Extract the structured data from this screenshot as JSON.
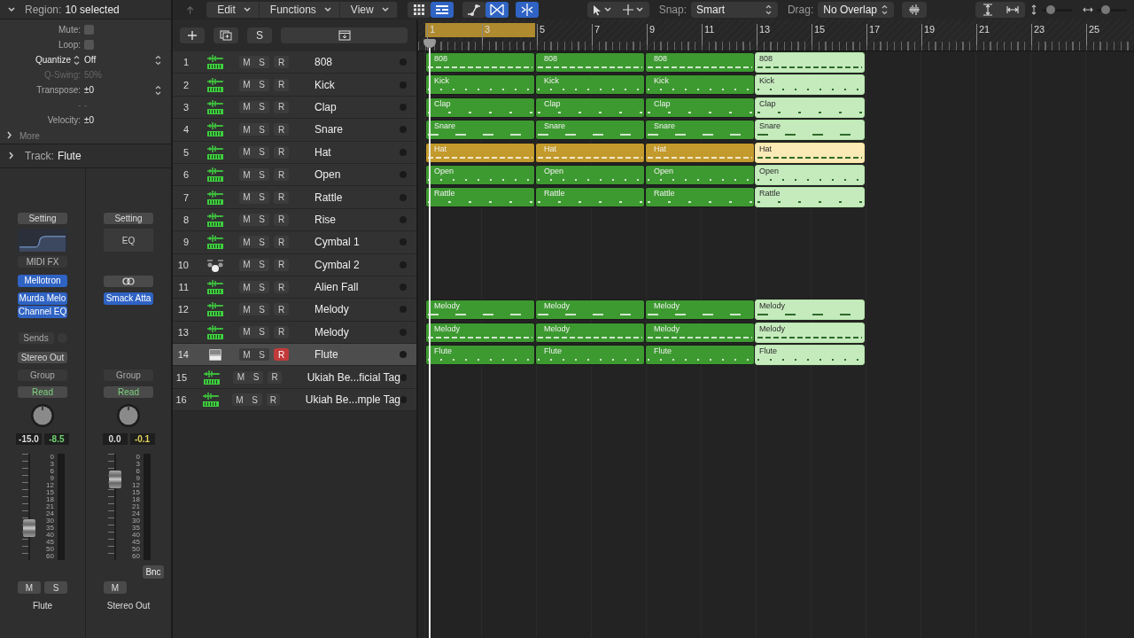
{
  "inspector": {
    "region": {
      "label": "Region:",
      "value": "10 selected",
      "expanded": true,
      "params": [
        {
          "kind": "checkbox",
          "label": "Mute:",
          "checked": false
        },
        {
          "kind": "checkbox",
          "label": "Loop:",
          "checked": false
        },
        {
          "kind": "popup",
          "label": "Quantize",
          "value": "Off"
        },
        {
          "kind": "value",
          "label": "Q-Swing:",
          "value": "50%",
          "disabled": true
        },
        {
          "kind": "stepper",
          "label": "Transpose:",
          "value": "±0"
        },
        {
          "kind": "value",
          "label": "-",
          "value": "-",
          "disabled": true
        },
        {
          "kind": "value",
          "label": "Velocity:",
          "value": "±0"
        }
      ]
    },
    "more": {
      "label": "More",
      "expanded": false
    },
    "track": {
      "label": "Track:",
      "value": "Flute",
      "expanded": false
    }
  },
  "strips": [
    {
      "setting": "Setting",
      "eq": {
        "kind": "curve"
      },
      "midi_fx": "MIDI FX",
      "input": {
        "kind": "plugin",
        "label": "Mellotron"
      },
      "plugins": [
        "Murda Melo",
        "Channel EQ"
      ],
      "sends": "Sends",
      "output": "Stereo Out",
      "group": "Group",
      "automation": "Read",
      "volume": "-15.0",
      "peak": "-8.5",
      "color": "#6fd36f",
      "level": 0.3,
      "scale": [
        "0",
        "3",
        "6",
        "9",
        "12",
        "15",
        "18",
        "21",
        "24",
        "30",
        "35",
        "40",
        "45",
        "50",
        "60"
      ],
      "buttons": [
        "M",
        "S"
      ],
      "name": "Flute"
    },
    {
      "setting": "Setting",
      "eq": {
        "kind": "label",
        "label": "EQ"
      },
      "input": {
        "kind": "link"
      },
      "plugins": [
        "Smack Atta"
      ],
      "group": "Group",
      "automation": "Read",
      "volume": "0.0",
      "peak": "-0.1",
      "color": "#e0d25a",
      "level": 0.76,
      "scale": [
        "0",
        "3",
        "6",
        "9",
        "12",
        "15",
        "18",
        "21",
        "24",
        "30",
        "35",
        "40",
        "45",
        "50",
        "60"
      ],
      "bounce": "Bnc",
      "buttons": [
        "M"
      ],
      "name": "Stereo Out"
    }
  ],
  "toolbar": {
    "menus": [
      "Edit",
      "Functions",
      "View"
    ],
    "toggles": [
      {
        "kind": "grid",
        "selected": false
      },
      {
        "kind": "list",
        "selected": true
      },
      {
        "kind": "automation",
        "selected": false
      },
      {
        "kind": "flex",
        "selected": true
      },
      {
        "kind": "catch",
        "selected": true
      }
    ],
    "snap": {
      "label": "Snap:",
      "value": "Smart"
    },
    "drag": {
      "label": "Drag:",
      "value": "No Overlap"
    },
    "zoom_sliders": [
      {
        "kind": "vertical",
        "level": 0.3
      },
      {
        "kind": "horizontal",
        "level": 0.3
      }
    ]
  },
  "track_header_bar": {
    "solo_button": "S"
  },
  "ruler": {
    "cycle": true,
    "marks": [
      "1",
      "3",
      "5",
      "7",
      "9",
      "11",
      "13",
      "15",
      "17",
      "19",
      "21",
      "23",
      "25"
    ]
  },
  "tracks": [
    {
      "number": "1",
      "kind": "midi",
      "buttons": [
        "M",
        "S",
        "R"
      ],
      "record": false,
      "name": "808",
      "selected": false,
      "regions": [
        {
          "label": "808",
          "selected": false,
          "color": "#3d9a30"
        },
        {
          "label": "808",
          "selected": false,
          "color": "#3d9a30"
        },
        {
          "label": "808",
          "selected": false,
          "color": "#3d9a30"
        },
        {
          "label": "808",
          "selected": true,
          "color": "#c5ebbd"
        }
      ]
    },
    {
      "number": "2",
      "kind": "midi",
      "buttons": [
        "M",
        "S",
        "R"
      ],
      "record": false,
      "name": "Kick",
      "selected": false,
      "regions": [
        {
          "label": "Kick",
          "selected": false,
          "color": "#3d9a30"
        },
        {
          "label": "Kick",
          "selected": false,
          "color": "#3d9a30"
        },
        {
          "label": "Kick",
          "selected": false,
          "color": "#3d9a30"
        },
        {
          "label": "Kick",
          "selected": true,
          "color": "#c5ebbd"
        }
      ]
    },
    {
      "number": "3",
      "kind": "midi",
      "buttons": [
        "M",
        "S",
        "R"
      ],
      "record": false,
      "name": "Clap",
      "selected": false,
      "regions": [
        {
          "label": "Clap",
          "selected": false,
          "color": "#3d9a30"
        },
        {
          "label": "Clap",
          "selected": false,
          "color": "#3d9a30"
        },
        {
          "label": "Clap",
          "selected": false,
          "color": "#3d9a30"
        },
        {
          "label": "Clap",
          "selected": true,
          "color": "#c5ebbd"
        }
      ]
    },
    {
      "number": "4",
      "kind": "midi",
      "buttons": [
        "M",
        "S",
        "R"
      ],
      "record": false,
      "name": "Snare",
      "selected": false,
      "regions": [
        {
          "label": "Snare",
          "selected": false,
          "color": "#3d9a30"
        },
        {
          "label": "Snare",
          "selected": false,
          "color": "#3d9a30"
        },
        {
          "label": "Snare",
          "selected": false,
          "color": "#3d9a30"
        },
        {
          "label": "Snare",
          "selected": true,
          "color": "#c5ebbd"
        }
      ]
    },
    {
      "number": "5",
      "kind": "midi",
      "buttons": [
        "M",
        "S",
        "R"
      ],
      "record": false,
      "name": "Hat",
      "selected": false,
      "regions": [
        {
          "label": "Hat",
          "selected": false,
          "color": "#c39a2c"
        },
        {
          "label": "Hat",
          "selected": false,
          "color": "#c39a2c"
        },
        {
          "label": "Hat",
          "selected": false,
          "color": "#c39a2c"
        },
        {
          "label": "Hat",
          "selected": true,
          "color": "#fbeab5"
        }
      ]
    },
    {
      "number": "6",
      "kind": "midi",
      "buttons": [
        "M",
        "S",
        "R"
      ],
      "record": false,
      "name": "Open",
      "selected": false,
      "regions": [
        {
          "label": "Open",
          "selected": false,
          "color": "#3d9a30"
        },
        {
          "label": "Open",
          "selected": false,
          "color": "#3d9a30"
        },
        {
          "label": "Open",
          "selected": false,
          "color": "#3d9a30"
        },
        {
          "label": "Open",
          "selected": true,
          "color": "#c5ebbd"
        }
      ]
    },
    {
      "number": "7",
      "kind": "midi",
      "buttons": [
        "M",
        "S",
        "R"
      ],
      "record": false,
      "name": "Rattle",
      "selected": false,
      "regions": [
        {
          "label": "Rattle",
          "selected": false,
          "color": "#3d9a30"
        },
        {
          "label": "Rattle",
          "selected": false,
          "color": "#3d9a30"
        },
        {
          "label": "Rattle",
          "selected": false,
          "color": "#3d9a30"
        },
        {
          "label": "Rattle",
          "selected": true,
          "color": "#c5ebbd"
        }
      ]
    },
    {
      "number": "8",
      "kind": "midi",
      "buttons": [
        "M",
        "S",
        "R"
      ],
      "record": false,
      "name": "Rise",
      "selected": false
    },
    {
      "number": "9",
      "kind": "midi",
      "buttons": [
        "M",
        "S",
        "R"
      ],
      "record": false,
      "name": "Cymbal 1",
      "selected": false
    },
    {
      "number": "10",
      "kind": "drummer",
      "buttons": [
        "M",
        "S",
        "R"
      ],
      "record": false,
      "name": "Cymbal 2",
      "selected": false
    },
    {
      "number": "11",
      "kind": "midi",
      "buttons": [
        "M",
        "S",
        "R"
      ],
      "record": false,
      "name": "Alien Fall",
      "selected": false
    },
    {
      "number": "12",
      "kind": "midi",
      "buttons": [
        "M",
        "S",
        "R"
      ],
      "record": false,
      "name": "Melody",
      "selected": false,
      "regions": [
        {
          "label": "Melody",
          "selected": false,
          "color": "#3d9a30"
        },
        {
          "label": "Melody",
          "selected": false,
          "color": "#3d9a30"
        },
        {
          "label": "Melody",
          "selected": false,
          "color": "#3d9a30"
        },
        {
          "label": "Melody",
          "selected": true,
          "color": "#c5ebbd"
        }
      ]
    },
    {
      "number": "13",
      "kind": "midi",
      "buttons": [
        "M",
        "S",
        "R"
      ],
      "record": false,
      "name": "Melody",
      "selected": false,
      "regions": [
        {
          "label": "Melody",
          "selected": false,
          "color": "#3d9a30"
        },
        {
          "label": "Melody",
          "selected": false,
          "color": "#3d9a30"
        },
        {
          "label": "Melody",
          "selected": false,
          "color": "#3d9a30"
        },
        {
          "label": "Melody",
          "selected": true,
          "color": "#c5ebbd"
        }
      ]
    },
    {
      "number": "14",
      "kind": "keyboard",
      "buttons": [
        "M",
        "S",
        "R"
      ],
      "record": true,
      "name": "Flute",
      "selected": true,
      "regions": [
        {
          "label": "Flute",
          "selected": false,
          "color": "#3d9a30"
        },
        {
          "label": "Flute",
          "selected": false,
          "color": "#3d9a30"
        },
        {
          "label": "Flute",
          "selected": false,
          "color": "#3d9a30"
        },
        {
          "label": "Flute",
          "selected": true,
          "color": "#c5ebbd"
        }
      ]
    },
    {
      "number": "15",
      "kind": "midi",
      "buttons": [
        "M",
        "S",
        "R"
      ],
      "record": false,
      "name": "Ukiah Be...ficial Tag",
      "selected": false
    },
    {
      "number": "16",
      "kind": "midi",
      "buttons": [
        "M",
        "S",
        "R"
      ],
      "record": false,
      "name": "Ukiah Be...mple Tag",
      "selected": false
    }
  ]
}
